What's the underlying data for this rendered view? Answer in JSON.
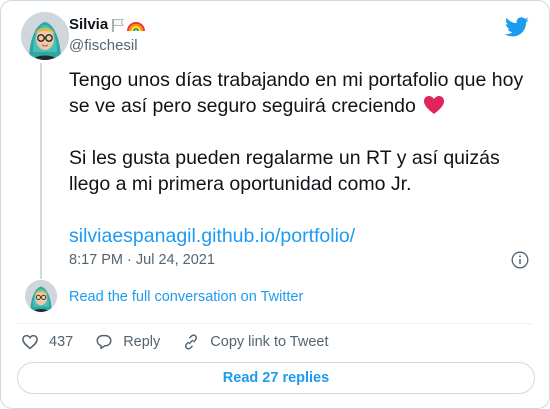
{
  "author": {
    "display_name": "Silvia",
    "handle": "@fischesil",
    "name_emoji": [
      "white-flag-icon",
      "rainbow-icon"
    ]
  },
  "tweet": {
    "line1": "Tengo unos días trabajando en mi portafolio que hoy se ve así pero seguro seguirá creciendo",
    "line2": "Si les  gusta pueden regalarme un RT  y así quizás llego a mi primera oportunidad como Jr.",
    "link_text": "silviaespanagil.github.io/portfolio/",
    "timestamp": "8:17 PM · Jul 24, 2021"
  },
  "conversation": {
    "read_label": "Read the full conversation on Twitter"
  },
  "actions": {
    "like_count": "437",
    "reply_label": "Reply",
    "copy_label": "Copy link to Tweet"
  },
  "replies_button": {
    "label": "Read 27 replies"
  },
  "colors": {
    "accent": "#1d9bf0",
    "muted": "#536471",
    "heart": "#e0245e"
  }
}
